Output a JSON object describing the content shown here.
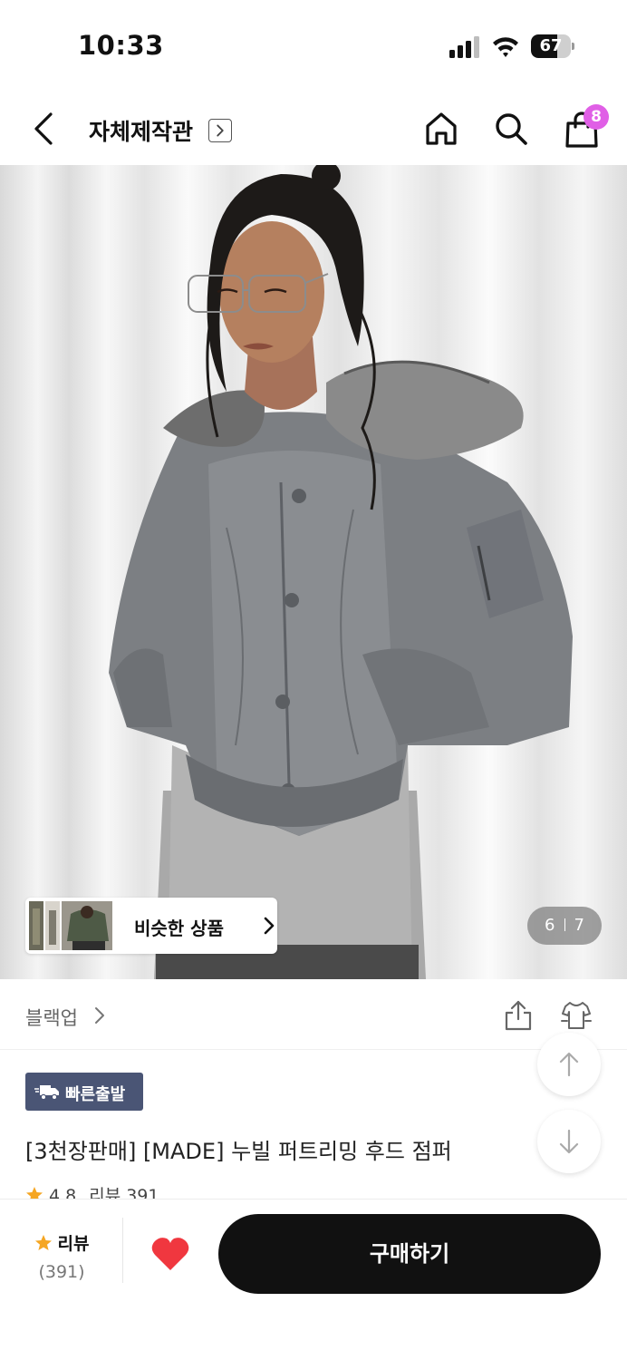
{
  "status_bar": {
    "time": "10:33",
    "battery": "67",
    "battery_level": 0.67
  },
  "header": {
    "store_title": "자체제작관",
    "cart_count": "8"
  },
  "gallery": {
    "similar_label": "비슷한 상품",
    "page_current": "6",
    "page_total": "7"
  },
  "brand": {
    "name": "블랙업"
  },
  "product": {
    "fast_badge": "빠른출발",
    "title": "[3천장판매] [MADE] 누빌 퍼트리밍 후드 점퍼",
    "rating": "4.8",
    "review_label": "리뷰 391"
  },
  "bottom_bar": {
    "review_label": "리뷰",
    "review_count": "(391)",
    "buy_label": "구매하기"
  },
  "colors": {
    "accent_badge": "#e05fe6",
    "fast_badge_bg": "#4a5575",
    "star": "#f5a623",
    "heart": "#f0373f",
    "buy_bg": "#111111"
  }
}
